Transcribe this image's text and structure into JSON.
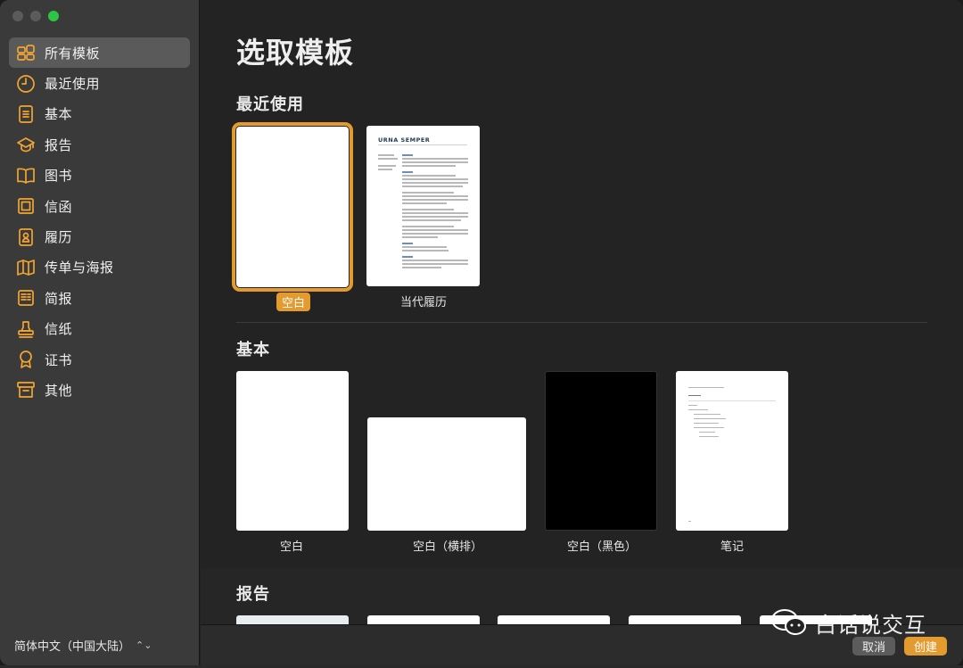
{
  "sidebar": {
    "items": [
      {
        "label": "所有模板",
        "icon": "templates-grid-icon",
        "active": true
      },
      {
        "label": "最近使用",
        "icon": "clock-icon",
        "active": false
      },
      {
        "label": "基本",
        "icon": "document-icon",
        "active": false
      },
      {
        "label": "报告",
        "icon": "graduation-cap-icon",
        "active": false
      },
      {
        "label": "图书",
        "icon": "book-icon",
        "active": false
      },
      {
        "label": "信函",
        "icon": "letter-icon",
        "active": false
      },
      {
        "label": "履历",
        "icon": "resume-person-icon",
        "active": false
      },
      {
        "label": "传单与海报",
        "icon": "map-fold-icon",
        "active": false
      },
      {
        "label": "简报",
        "icon": "newsletter-icon",
        "active": false
      },
      {
        "label": "信纸",
        "icon": "stamp-icon",
        "active": false
      },
      {
        "label": "证书",
        "icon": "ribbon-icon",
        "active": false
      },
      {
        "label": "其他",
        "icon": "archive-box-icon",
        "active": false
      }
    ],
    "language": "简体中文（中国大陆）",
    "language_chevron": "⌃⌄"
  },
  "main": {
    "title": "选取模板",
    "recent": {
      "title": "最近使用",
      "templates": [
        {
          "label": "空白",
          "selected": true
        },
        {
          "label": "当代履历",
          "selected": false
        }
      ],
      "resume_name": "URNA SEMPER"
    },
    "basic": {
      "title": "基本",
      "templates": [
        {
          "label": "空白"
        },
        {
          "label": "空白（横排）"
        },
        {
          "label": "空白（黑色）"
        },
        {
          "label": "笔记"
        }
      ]
    },
    "reports": {
      "title": "报告"
    }
  },
  "footer": {
    "cancel_label": "取消",
    "create_label": "创建"
  },
  "watermark": {
    "text": "白话说交互"
  },
  "colors": {
    "accent": "#e39a2e",
    "icon_orange": "#f2a531",
    "sidebar_bg": "#3a3a3a",
    "main_bg": "#232323"
  }
}
